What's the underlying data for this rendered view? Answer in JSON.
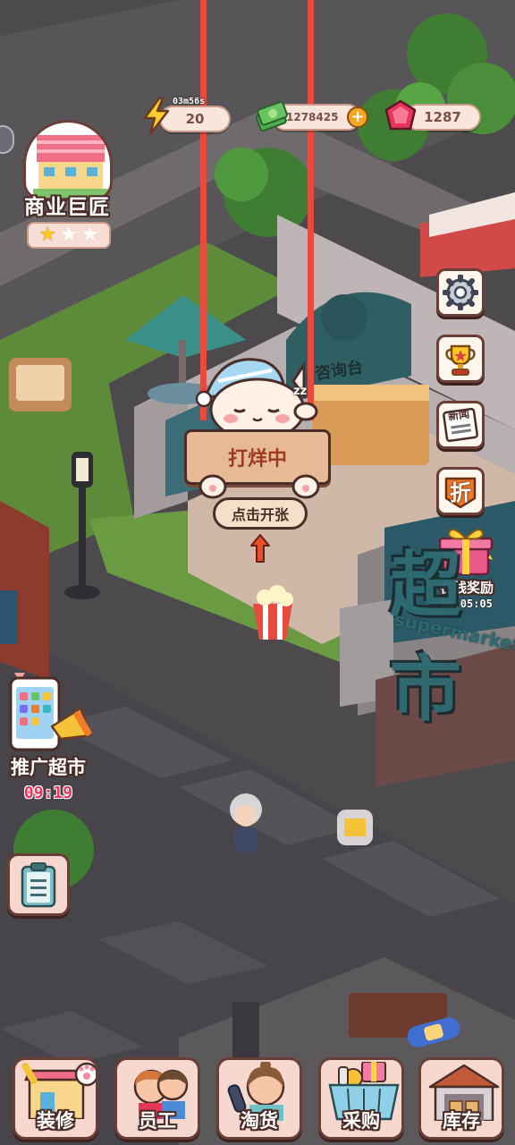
{
  "hud": {
    "energy": {
      "timer": "03m56s",
      "value": "20",
      "icon": "lightning-icon"
    },
    "cash": {
      "value": "1278425",
      "icon": "cash-stack-icon",
      "add_icon": "plus-icon"
    },
    "gems": {
      "value": "1287",
      "icon": "ruby-gem-icon"
    }
  },
  "profile": {
    "title": "商业巨匠",
    "stars_filled": 1,
    "stars_total": 3
  },
  "store_sign": {
    "status": "打烊中",
    "action": "点击开张",
    "cat_sleep": "zz"
  },
  "info_desk_label": "咨询台",
  "side_menu": [
    {
      "name": "settings-button",
      "icon": "gear-icon"
    },
    {
      "name": "trophy-button",
      "icon": "trophy-icon"
    },
    {
      "name": "news-button",
      "icon": "newspaper-icon",
      "label": "新闻"
    },
    {
      "name": "discount-button",
      "icon": "discount-tag-icon",
      "label": "折"
    }
  ],
  "online_reward": {
    "label": "在线奖励",
    "timer": "00:05:05"
  },
  "building": {
    "sign": "超市",
    "subsign": "supermarket"
  },
  "promo": {
    "label": "推广超市",
    "timer": "09:19"
  },
  "bottom_nav": [
    {
      "name": "decorate",
      "label": "装修"
    },
    {
      "name": "staff",
      "label": "员工"
    },
    {
      "name": "scout-goods",
      "label": "淘货"
    },
    {
      "name": "purchase",
      "label": "采购"
    },
    {
      "name": "inventory",
      "label": "库存"
    }
  ],
  "colors": {
    "road": "#4d4a4e",
    "grass": "#5e8b3a",
    "sign_wood": "#e8b996",
    "accent_red": "#e84a3e",
    "pill_bg": "#f8e6dc",
    "outline": "#4b2d28"
  }
}
